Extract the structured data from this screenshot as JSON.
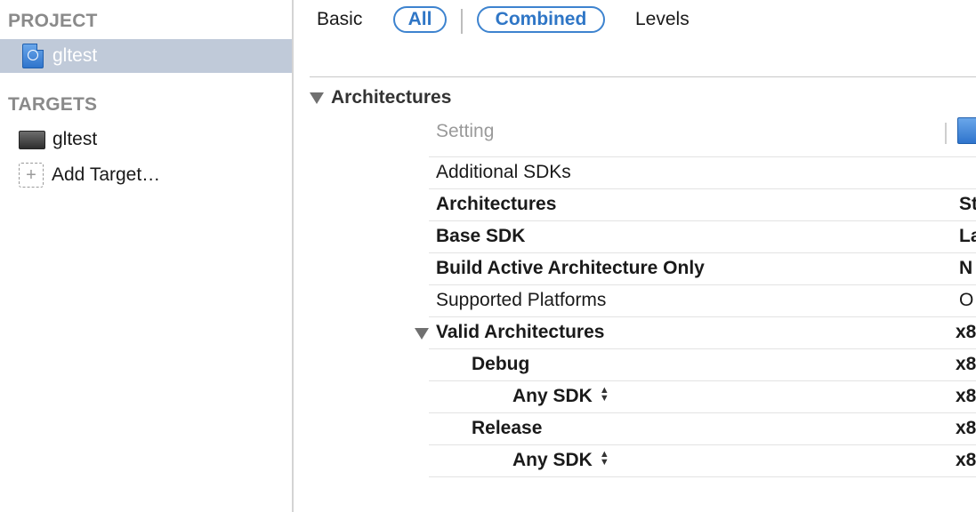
{
  "sidebar": {
    "project_header": "PROJECT",
    "project_item": "gltest",
    "targets_header": "TARGETS",
    "target_item": "gltest",
    "add_target": "Add Target…"
  },
  "filters": {
    "basic": "Basic",
    "all": "All",
    "combined": "Combined",
    "levels": "Levels"
  },
  "group": {
    "title": "Architectures"
  },
  "columns": {
    "setting": "Setting"
  },
  "rows": [
    {
      "name": "Additional SDKs",
      "value": ""
    },
    {
      "name": "Architectures",
      "value": "St"
    },
    {
      "name": "Base SDK",
      "value": "La"
    },
    {
      "name": "Build Active Architecture Only",
      "value": "N"
    },
    {
      "name": "Supported Platforms",
      "value": "O"
    },
    {
      "name": "Valid Architectures",
      "value": "x8"
    },
    {
      "name": "Debug",
      "value": "x8"
    },
    {
      "name": "Any SDK",
      "value": "x8"
    },
    {
      "name": "Release",
      "value": "x8"
    },
    {
      "name": "Any SDK",
      "value": "x8"
    }
  ],
  "colors": {
    "selection": "#c0cad9",
    "accent": "#3d83cf"
  },
  "icons": {
    "project": "project-file-icon",
    "target": "app-target-icon",
    "add": "add-target-icon",
    "disclosure": "disclosure-triangle-icon",
    "stepper": "sdk-stepper-icon"
  }
}
